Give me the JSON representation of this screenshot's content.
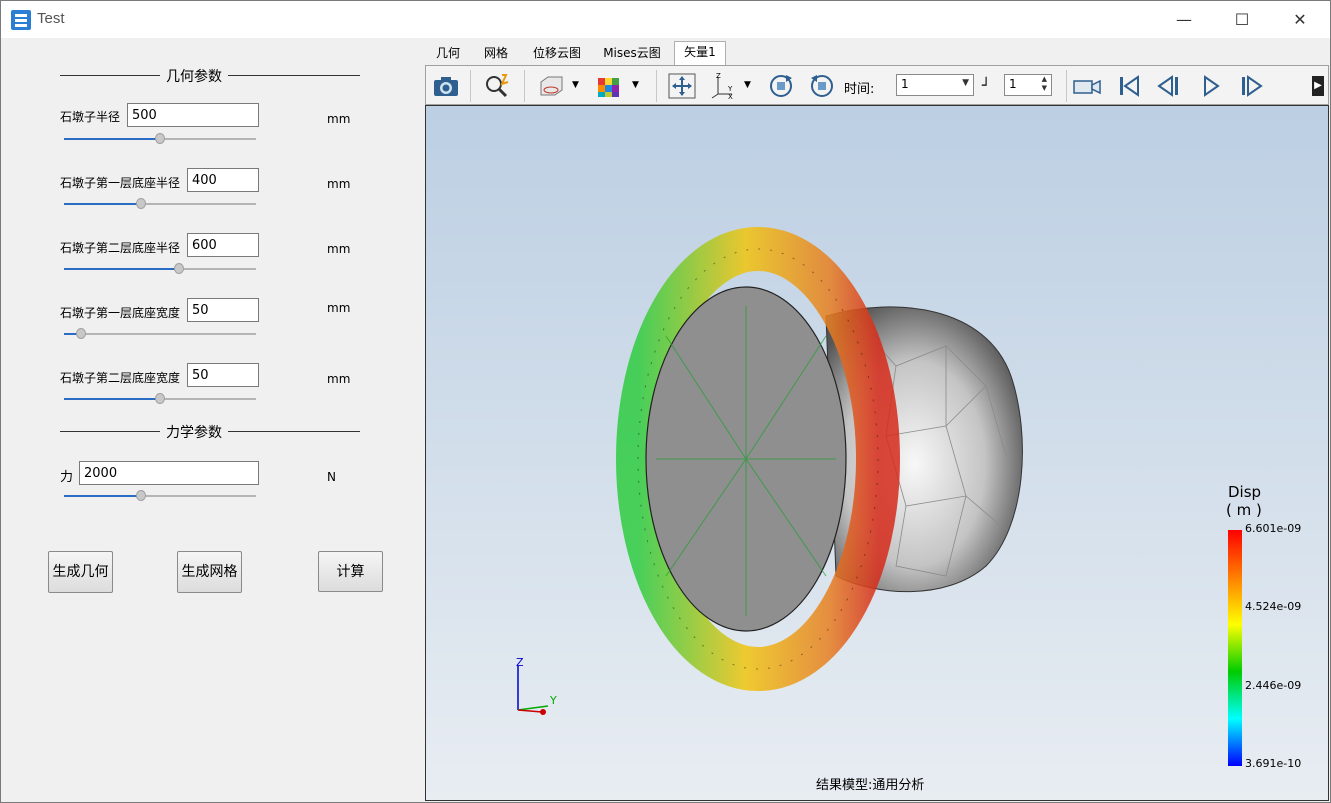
{
  "window": {
    "title": "Test"
  },
  "geometry_group": {
    "title": "几何参数"
  },
  "params": [
    {
      "label": "石墩子半径",
      "value": "500",
      "unit": "mm",
      "slider": 0.5
    },
    {
      "label": "石墩子第一层底座半径",
      "value": "400",
      "unit": "mm",
      "slider": 0.4
    },
    {
      "label": "石墩子第二层底座半径",
      "value": "600",
      "unit": "mm",
      "slider": 0.6
    },
    {
      "label": "石墩子第一层底座宽度",
      "value": "50",
      "unit": "mm",
      "slider": 0.08
    },
    {
      "label": "石墩子第二层底座宽度",
      "value": "50",
      "unit": "mm",
      "slider": 0.5
    }
  ],
  "mechanics_group": {
    "title": "力学参数"
  },
  "force": {
    "label": "力",
    "value": "2000",
    "unit": "N",
    "slider": 0.4
  },
  "buttons": {
    "gen_geometry": "生成几何",
    "gen_mesh": "生成网格",
    "compute": "计算"
  },
  "tabs": [
    "几何",
    "网格",
    "位移云图",
    "Mises云图",
    "矢量1"
  ],
  "active_tab": "矢量1",
  "toolbar": {
    "time_label": "时间:",
    "time_value": "1",
    "step_value": "1"
  },
  "viewport": {
    "caption": "结果模型:通用分析"
  },
  "legend": {
    "title": "Disp",
    "unit": "( m )",
    "ticks": [
      "6.601e-09",
      "4.524e-09",
      "2.446e-09",
      "3.691e-10"
    ]
  },
  "axes": {
    "z": "Z",
    "y": "Y"
  },
  "colors": {
    "accent": "#2b6cc4",
    "viewport_top": "#bccfe3",
    "viewport_bottom": "#e8edf2"
  }
}
